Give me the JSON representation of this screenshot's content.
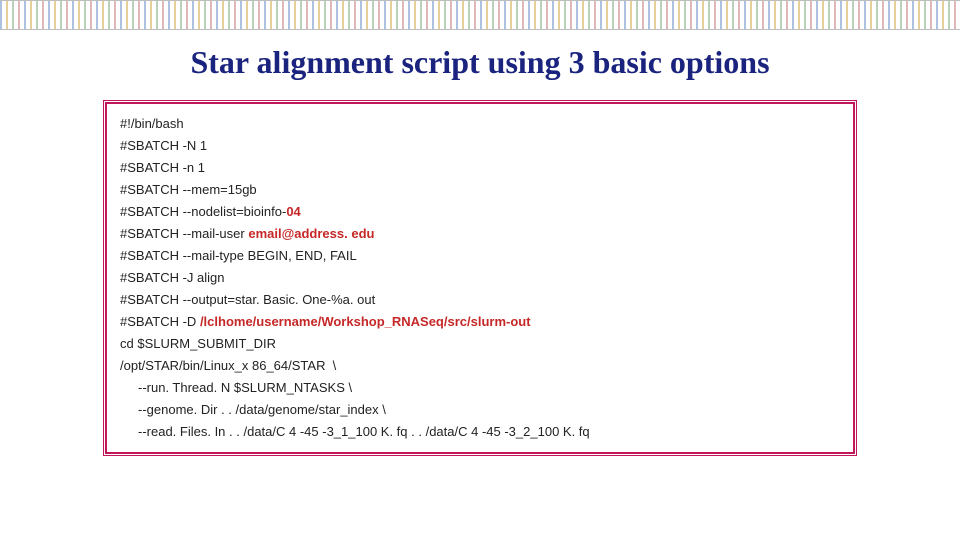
{
  "title": "Star alignment script using 3 basic options",
  "script": {
    "l0": "#!/bin/bash",
    "l1": "#SBATCH -N 1",
    "l2": "#SBATCH -n 1",
    "l3": "#SBATCH --mem=15gb",
    "l4a": "#SBATCH --nodelist=bioinfo-",
    "l4b": "04",
    "l5a": "#SBATCH --mail-user ",
    "l5b": "email@address. edu",
    "l6": "#SBATCH --mail-type BEGIN, END, FAIL",
    "l7": "#SBATCH -J align",
    "l8": "#SBATCH --output=star. Basic. One-%a. out",
    "l9a": "#SBATCH -D ",
    "l9b": "/lclhome/username/Workshop_RNASeq/src/slurm-out",
    "l10": "cd $SLURM_SUBMIT_DIR",
    "l11": "/opt/STAR/bin/Linux_x 86_64/STAR  \\",
    "l12": "--run. Thread. N $SLURM_NTASKS \\",
    "l13": "--genome. Dir . . /data/genome/star_index \\",
    "l14": "--read. Files. In . . /data/C 4 -45 -3_1_100 K. fq . . /data/C 4 -45 -3_2_100 K. fq"
  }
}
